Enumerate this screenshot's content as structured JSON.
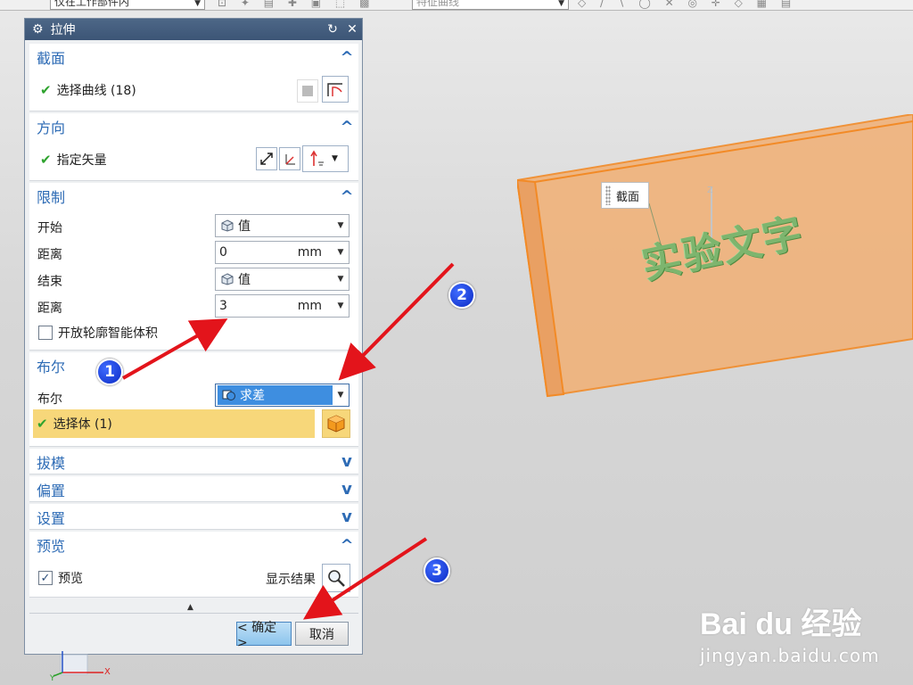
{
  "toolbar": {
    "filter_combo": "仅在工作部件内",
    "curve_combo": "特征曲线"
  },
  "dialog": {
    "title": "拉伸",
    "section_section": {
      "title": "截面",
      "select_curve": "选择曲线 (18)"
    },
    "section_direction": {
      "title": "方向",
      "specify_vector": "指定矢量"
    },
    "section_limits": {
      "title": "限制",
      "start_label": "开始",
      "start_value": "值",
      "distance1_label": "距离",
      "distance1_value": "0",
      "distance1_unit": "mm",
      "end_label": "结束",
      "end_value": "值",
      "distance2_label": "距离",
      "distance2_value": "3",
      "distance2_unit": "mm",
      "open_profile_label": "开放轮廓智能体积"
    },
    "section_boolean": {
      "title": "布尔",
      "boolean_label": "布尔",
      "boolean_value": "求差",
      "select_body": "选择体 (1)"
    },
    "section_draft": {
      "title": "拔模"
    },
    "section_offset": {
      "title": "偏置"
    },
    "section_settings": {
      "title": "设置"
    },
    "section_preview": {
      "title": "预览",
      "preview_label": "预览",
      "show_result": "显示结果"
    },
    "ok_button": "< 确定 >",
    "cancel_button": "取消"
  },
  "graphics": {
    "section_tag": "截面",
    "engraved_text": "实验文字",
    "badges": [
      "1",
      "2",
      "3"
    ],
    "watermark_brand": "Bai du 经验",
    "watermark_site": "jingyan.baidu.com"
  },
  "colors": {
    "title_bar": "#3f5a7d",
    "section_heading": "#2d6bb5",
    "check": "#2ea32e",
    "selection_highlight": "#f7d77a",
    "boolean_fill": "#3e8ee0",
    "arrow": "#e3141b"
  }
}
